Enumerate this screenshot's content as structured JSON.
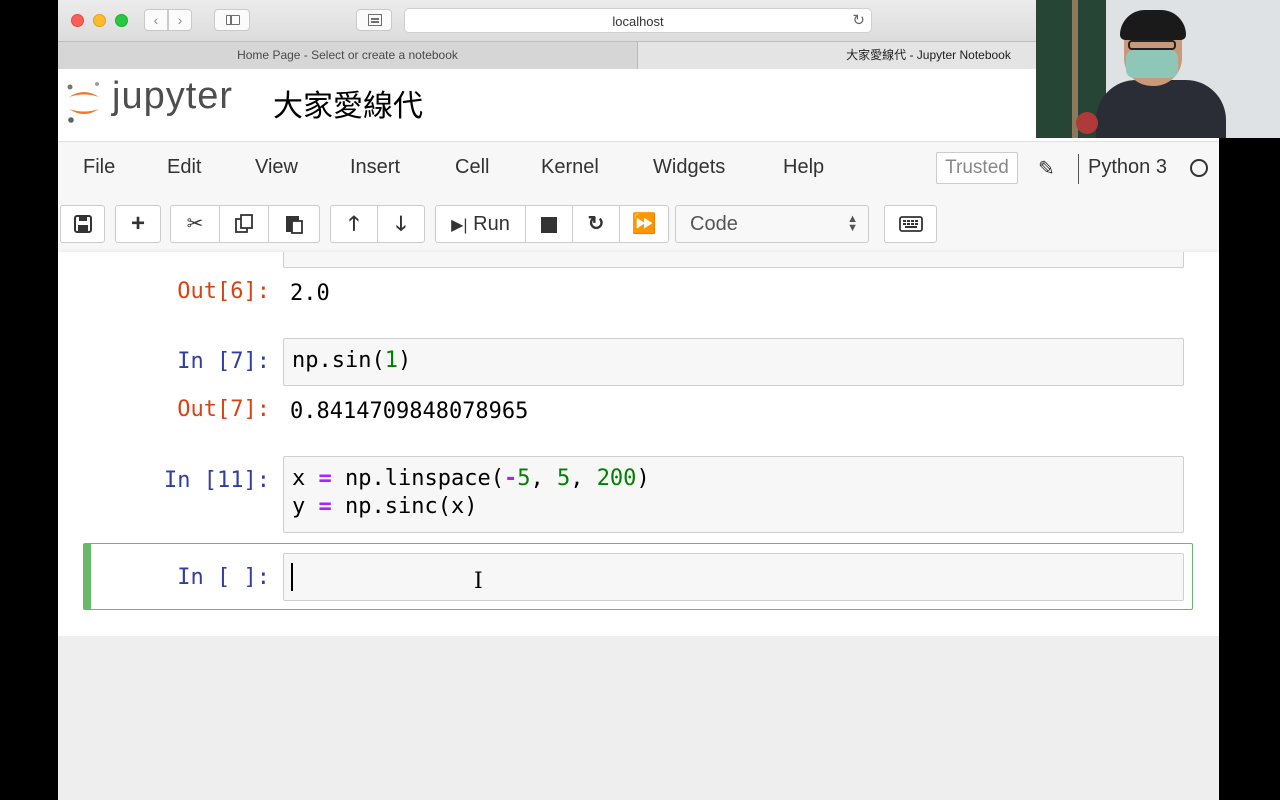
{
  "browser": {
    "url": "localhost",
    "tabs": [
      {
        "label": "Home Page - Select or create a notebook"
      },
      {
        "label": "大家愛線代 - Jupyter Notebook"
      }
    ]
  },
  "header": {
    "logo_text": "jupyter",
    "notebook_title": "大家愛線代"
  },
  "menu": {
    "items": [
      "File",
      "Edit",
      "View",
      "Insert",
      "Cell",
      "Kernel",
      "Widgets",
      "Help"
    ],
    "trusted_label": "Trusted",
    "kernel_name": "Python 3"
  },
  "toolbar": {
    "run_label": "Run",
    "cell_type": "Code"
  },
  "cells": [
    {
      "out_prompt": "Out[6]:",
      "output": "2.0"
    },
    {
      "in_prompt": "In [7]:",
      "code": "np.sin(1)",
      "out_prompt": "Out[7]:",
      "output": "0.8414709848078965"
    },
    {
      "in_prompt": "In [11]:",
      "code_lines": [
        "x = np.linspace(-5, 5, 200)",
        "y = np.sinc(x)"
      ]
    },
    {
      "in_prompt": "In [ ]:",
      "code": ""
    }
  ],
  "colors": {
    "in_prompt": "#303f9f",
    "out_prompt": "#d84315",
    "selected_cell_border": "#66bb6a",
    "operator": "#aa22ff",
    "number": "#008000"
  }
}
